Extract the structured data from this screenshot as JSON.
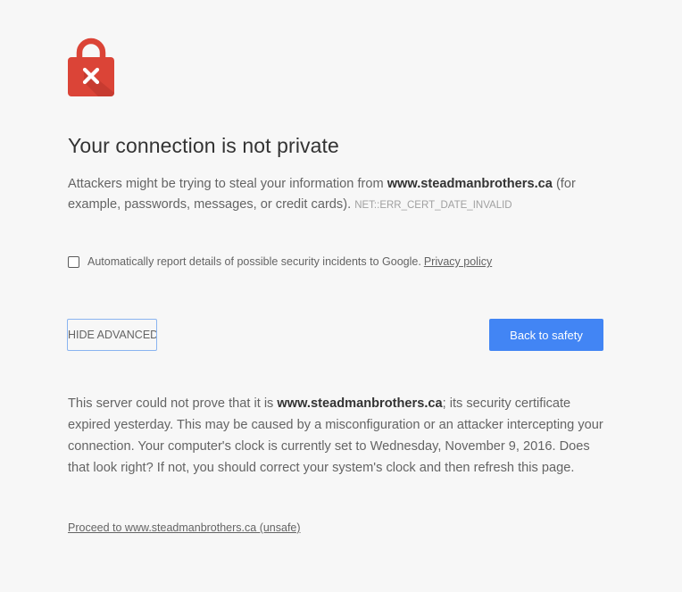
{
  "heading": "Your connection is not private",
  "intro": {
    "before_domain": "Attackers might be trying to steal your information from ",
    "domain": "www.steadmanbrothers.ca",
    "after_domain": " (for example, passwords, messages, or credit cards).",
    "error_code": "NET::ERR_CERT_DATE_INVALID"
  },
  "report": {
    "checked": false,
    "label": "Automatically report details of possible security incidents to Google.",
    "privacy_link": "Privacy policy"
  },
  "buttons": {
    "advanced": "HIDE ADVANCED",
    "back_to_safety": "Back to safety"
  },
  "details": {
    "before_domain": "This server could not prove that it is ",
    "domain": "www.steadmanbrothers.ca",
    "after_domain": "; its security certificate expired yesterday. This may be caused by a misconfiguration or an attacker intercepting your connection. Your computer's clock is currently set to Wednesday, November 9, 2016. Does that look right? If not, you should correct your system's clock and then refresh this page."
  },
  "proceed_link": "Proceed to www.steadmanbrothers.ca (unsafe)",
  "icon": "lock-error-icon",
  "colors": {
    "lock_red": "#db4437",
    "primary_blue": "#4285f4",
    "background": "#f7f7f7"
  }
}
